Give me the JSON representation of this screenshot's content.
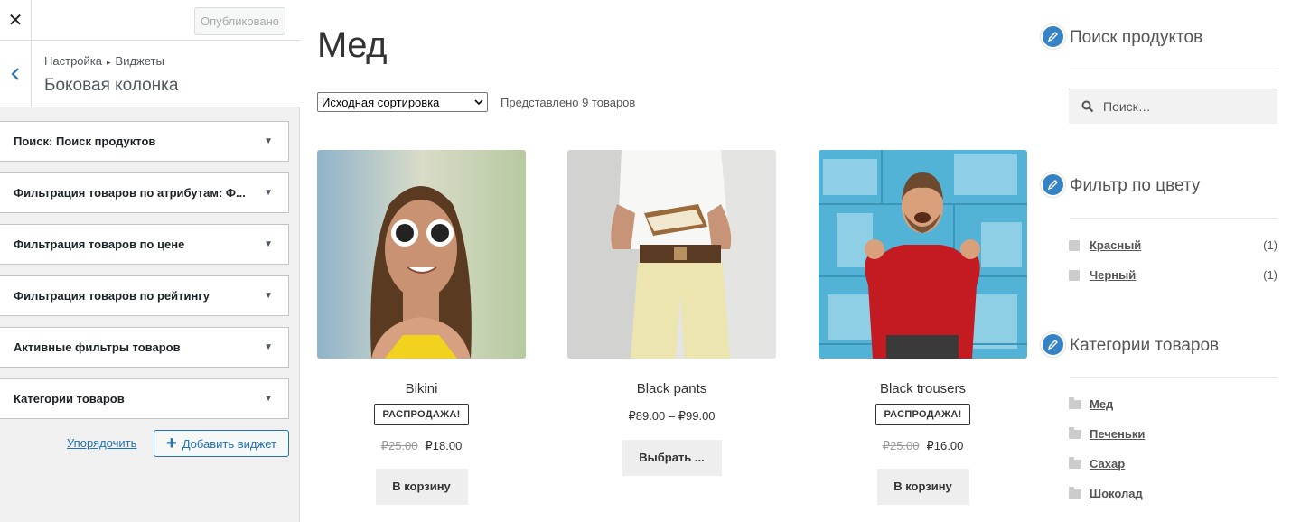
{
  "customizer": {
    "close_icon": "close-icon",
    "publish_label": "Опубликовано",
    "breadcrumb": {
      "root": "Настройка",
      "current": "Виджеты"
    },
    "section_title": "Боковая колонка",
    "widgets": [
      {
        "label": "Поиск: Поиск продуктов"
      },
      {
        "label": "Фильтрация товаров по атрибутам: Ф..."
      },
      {
        "label": "Фильтрация товаров по цене"
      },
      {
        "label": "Фильтрация товаров по рейтингу"
      },
      {
        "label": "Активные фильтры товаров"
      },
      {
        "label": "Категории товаров"
      }
    ],
    "reorder_label": "Упорядочить",
    "add_widget_label": "Добавить виджет"
  },
  "shop": {
    "title": "Мед",
    "sort_selected": "Исходная сортировка",
    "result_count": "Представлено 9 товаров",
    "products": [
      {
        "name": "Bikini",
        "badge": "РАСПРОДАЖА!",
        "old_price": "₽25.00",
        "price": "₽18.00",
        "button": "В корзину"
      },
      {
        "name": "Black pants",
        "price_range": "₽89.00 – ₽99.00",
        "button": "Выбрать ..."
      },
      {
        "name": "Black trousers",
        "badge": "РАСПРОДАЖА!",
        "old_price": "₽25.00",
        "price": "₽16.00",
        "button": "В корзину"
      }
    ]
  },
  "sidebar": {
    "search_title": "Поиск продуктов",
    "search_placeholder": "Поиск…",
    "color_title": "Фильтр по цвету",
    "colors": [
      {
        "label": "Красный",
        "count": "(1)"
      },
      {
        "label": "Черный",
        "count": "(1)"
      }
    ],
    "categories_title": "Категории товаров",
    "categories": [
      {
        "label": "Мед"
      },
      {
        "label": "Печеньки"
      },
      {
        "label": "Сахар"
      },
      {
        "label": "Шоколад"
      }
    ]
  },
  "colors": {
    "accent": "#2271b1",
    "edit_pen": "#3582c4"
  }
}
